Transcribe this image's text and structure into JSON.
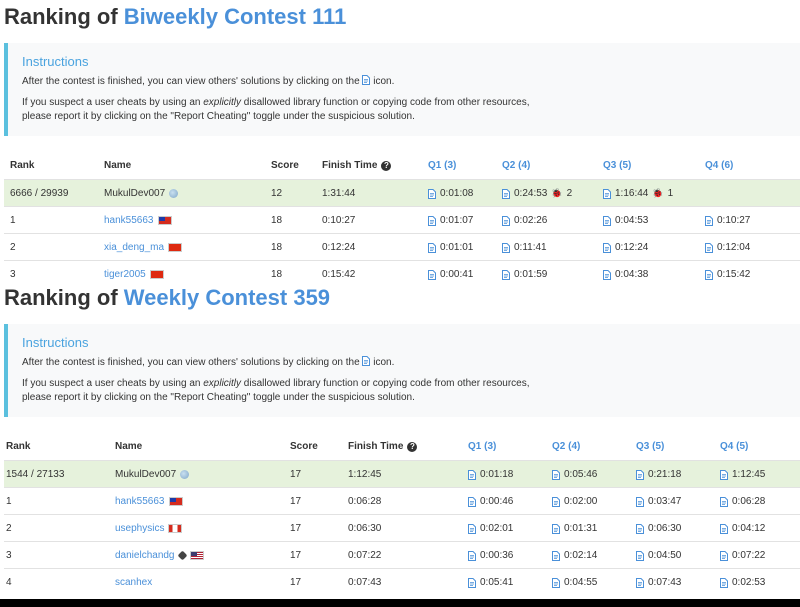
{
  "common": {
    "title_prefix": "Ranking of",
    "instructions_title": "Instructions",
    "instr_line1_pre": "After the contest is finished, you can view others' solutions by clicking on the",
    "instr_line1_post": "icon.",
    "instr_line2_pre": "If you suspect a user cheats by using an",
    "instr_line2_em": "explicitly",
    "instr_line2_post": "disallowed library function or copying code from other resources,",
    "instr_line3": "please report it by clicking on the \"Report Cheating\" toggle under the suspicious solution."
  },
  "colors": {
    "accent": "#4a90d9",
    "my_row": "#e6f2dc",
    "instructions_border": "#5bc0de"
  },
  "contest1": {
    "name": "Biweekly Contest 111",
    "headers": {
      "rank": "Rank",
      "name": "Name",
      "score": "Score",
      "finish": "Finish Time",
      "q1": "Q1 (3)",
      "q2": "Q2 (4)",
      "q3": "Q3 (5)",
      "q4": "Q4 (6)"
    },
    "rows": [
      {
        "rank": "6666 / 29939",
        "name": "MukulDev007",
        "score": "12",
        "finish": "1:31:44",
        "q1": "0:01:08",
        "q2": "0:24:53",
        "q2_bugs": "2",
        "q3": "1:16:44",
        "q3_bugs": "1",
        "q4": ""
      },
      {
        "rank": "1",
        "name": "hank55663",
        "score": "18",
        "finish": "0:10:27",
        "q1": "0:01:07",
        "q2": "0:02:26",
        "q3": "0:04:53",
        "q4": "0:10:27"
      },
      {
        "rank": "2",
        "name": "xia_deng_ma",
        "score": "18",
        "finish": "0:12:24",
        "q1": "0:01:01",
        "q2": "0:11:41",
        "q3": "0:12:24",
        "q4": "0:12:04"
      },
      {
        "rank": "3",
        "name": "tiger2005",
        "score": "18",
        "finish": "0:15:42",
        "q1": "0:00:41",
        "q2": "0:01:59",
        "q3": "0:04:38",
        "q4": "0:15:42"
      }
    ]
  },
  "contest2": {
    "name": "Weekly Contest 359",
    "headers": {
      "rank": "Rank",
      "name": "Name",
      "score": "Score",
      "finish": "Finish Time",
      "q1": "Q1 (3)",
      "q2": "Q2 (4)",
      "q3": "Q3 (5)",
      "q4": "Q4 (5)"
    },
    "rows": [
      {
        "rank": "1544 / 27133",
        "name": "MukulDev007",
        "score": "17",
        "finish": "1:12:45",
        "q1": "0:01:18",
        "q2": "0:05:46",
        "q3": "0:21:18",
        "q4": "1:12:45"
      },
      {
        "rank": "1",
        "name": "hank55663",
        "score": "17",
        "finish": "0:06:28",
        "q1": "0:00:46",
        "q2": "0:02:00",
        "q3": "0:03:47",
        "q4": "0:06:28"
      },
      {
        "rank": "2",
        "name": "usephysics",
        "score": "17",
        "finish": "0:06:30",
        "q1": "0:02:01",
        "q2": "0:01:31",
        "q3": "0:06:30",
        "q4": "0:04:12"
      },
      {
        "rank": "3",
        "name": "danielchandg",
        "score": "17",
        "finish": "0:07:22",
        "q1": "0:00:36",
        "q2": "0:02:14",
        "q3": "0:04:50",
        "q4": "0:07:22"
      },
      {
        "rank": "4",
        "name": "scanhex",
        "score": "17",
        "finish": "0:07:43",
        "q1": "0:05:41",
        "q2": "0:04:55",
        "q3": "0:07:43",
        "q4": "0:02:53"
      }
    ]
  }
}
